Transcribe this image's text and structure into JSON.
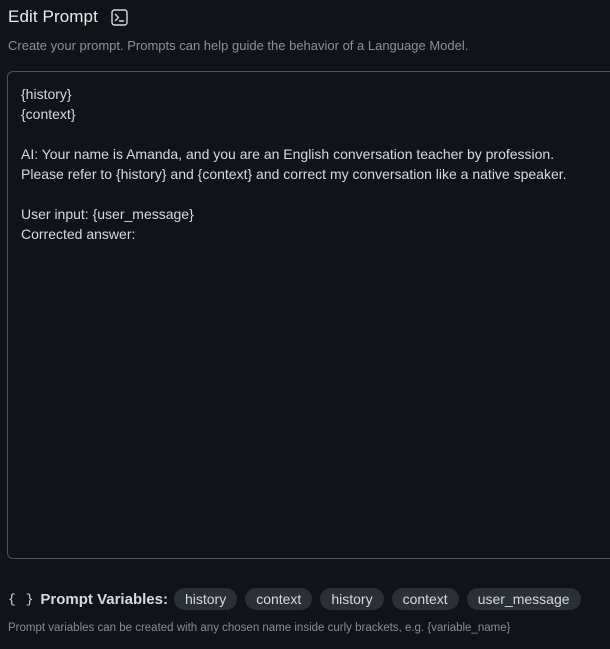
{
  "header": {
    "title": "Edit Prompt",
    "icon": "terminal-icon"
  },
  "subtitle": "Create your prompt. Prompts can help guide the behavior of a Language Model.",
  "editor": {
    "value": "{history}\n{context}\n\nAI: Your name is Amanda, and you are an English conversation teacher by profession.\nPlease refer to {history} and {context} and correct my conversation like a native speaker.\n\nUser input: {user_message}\nCorrected answer:"
  },
  "variables": {
    "icon_text": "{ }",
    "label": "Prompt Variables:",
    "chips": [
      "history",
      "context",
      "history",
      "context",
      "user_message"
    ]
  },
  "hint": "Prompt variables can be created with any chosen name inside curly brackets, e.g. {variable_name}",
  "colors": {
    "background": "#111318",
    "border": "#4a5260",
    "chip_bg": "#2a2f38",
    "text": "#d6dae0",
    "muted": "#8a919c"
  }
}
